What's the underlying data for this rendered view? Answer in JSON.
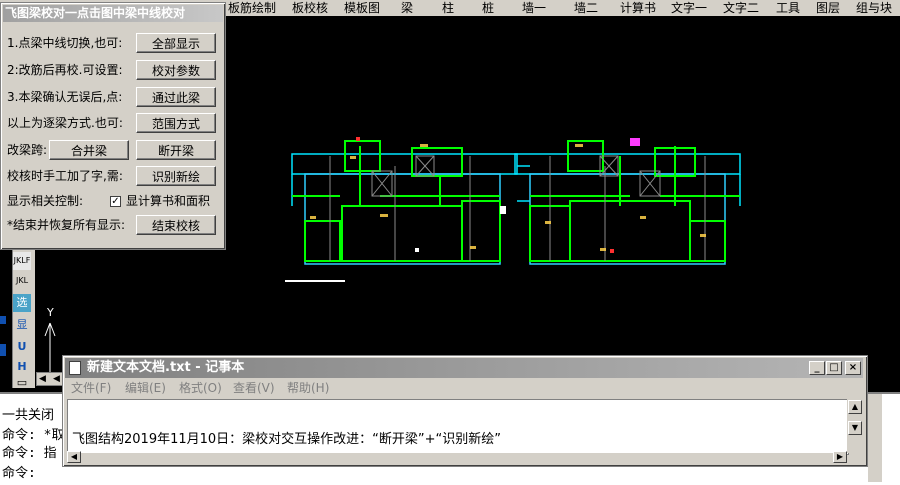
{
  "menubar": {
    "items": [
      "板筋绘制",
      "板校核",
      "模板图",
      "梁",
      "柱",
      "桩",
      "墙一",
      "墙二",
      "计算书",
      "文字一",
      "文字二",
      "工具",
      "图层",
      "组与块"
    ]
  },
  "dialog": {
    "title": "飞图梁校对一点击图中梁中线校对",
    "rows": [
      {
        "label": "1.点梁中线切换,也可:",
        "button": "全部显示"
      },
      {
        "label": "2:改筋后再校.可设置:",
        "button": "校对参数"
      },
      {
        "label": "3.本梁确认无误后,点:",
        "button": "通过此梁"
      },
      {
        "label": "以上为逐梁方式.也可:",
        "button": "范围方式"
      }
    ],
    "change_span_label": "改梁跨:",
    "merge_button": "合并梁",
    "split_button": "断开梁",
    "manual_label": "校核时手工加了字,需:",
    "recognize_button": "识别新绘",
    "display_label": "显示相关控制:",
    "checkbox_label": "显计算书和面积",
    "checkbox_checked": "✓",
    "end_label": "*结束并恢复所有显示:",
    "end_button": "结束校核"
  },
  "toolbar": {
    "icons": [
      "JKLF",
      "JKL",
      "选",
      "显",
      "U",
      "H",
      "▭"
    ]
  },
  "canvas": {
    "axis_y": "Y"
  },
  "command": {
    "lines": [
      "一共关闭",
      "命令: *取",
      "命令: 指",
      "命令:"
    ]
  },
  "notepad": {
    "title": "新建文本文档.txt - 记事本",
    "menu": [
      "文件(F)",
      "编辑(E)",
      "格式(O)",
      "查看(V)",
      "帮助(H)"
    ],
    "content": "飞图结构2019年11月10日：梁校对交互操作改进：“断开梁”+“识别新绘”",
    "min": "_",
    "max": "□",
    "close": "×"
  }
}
